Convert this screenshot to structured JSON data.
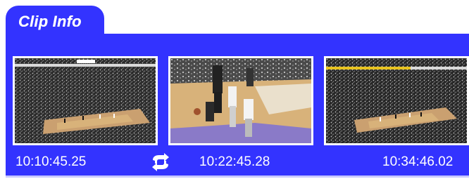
{
  "tab": {
    "title": "Clip Info"
  },
  "clips": [
    {
      "timecode": "10:10:45.25",
      "thumbnail": "arena-wide-shot"
    },
    {
      "timecode": "10:22:45.28",
      "thumbnail": "players-closeup"
    },
    {
      "timecode": "10:34:46.02",
      "thumbnail": "arena-wide-shot"
    }
  ],
  "controls": {
    "swap_icon": "swap-arrows-icon"
  },
  "colors": {
    "panel": "#3333ff",
    "text": "#ffffff",
    "court": "#d8b27a"
  }
}
